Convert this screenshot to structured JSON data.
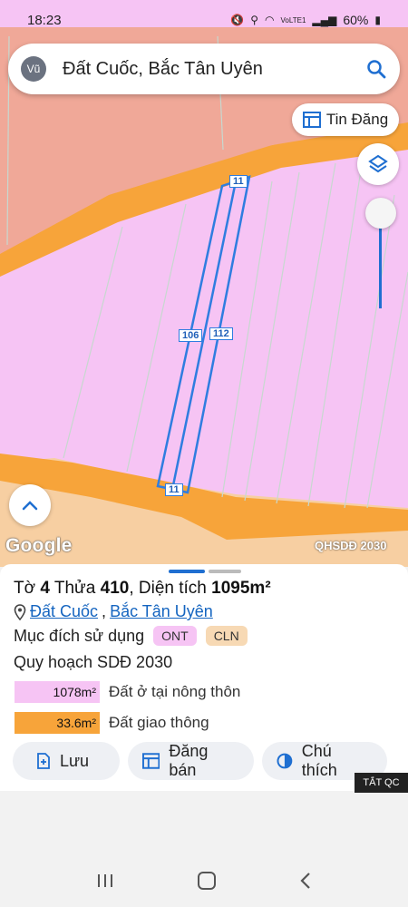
{
  "status": {
    "time": "18:23",
    "network": "VoLTE1",
    "battery": "60%"
  },
  "search": {
    "avatar": "Vũ",
    "query": "Đất Cuốc, Bắc Tân Uyên"
  },
  "map": {
    "tin_dang_label": "Tin Đăng",
    "parcel_labels": [
      "11",
      "106",
      "112",
      "11"
    ],
    "google_logo": "Google",
    "layer_label": "QHSDĐ 2030",
    "colors": {
      "residential_rural": "#f6c4f4",
      "road": "#f7a43a",
      "perennial": "#f0a898",
      "other": "#f7cfa2",
      "parcel_outline": "#2f7de0"
    }
  },
  "sheet": {
    "to_label": "Tờ",
    "to_value": "4",
    "thua_label": "Thửa",
    "thua_value": "410",
    "area_label": "Diện tích",
    "area_value": "1095m²",
    "location_part1": "Đất Cuốc",
    "location_part2": "Bắc Tân Uyên",
    "purpose_label": "Mục đích sử dụng",
    "purpose_tags": [
      "ONT",
      "CLN"
    ],
    "planning_label": "Quy hoạch SDĐ 2030",
    "legend": [
      {
        "area": "1078m²",
        "name": "Đất ở tại nông thôn",
        "color": "#f6c4f4"
      },
      {
        "area": "33.6m²",
        "name": "Đất giao thông",
        "color": "#f7a43a"
      }
    ],
    "actions": [
      "Lưu",
      "Đăng bán",
      "Chú thích"
    ]
  },
  "ad_label": "TẮT QC"
}
